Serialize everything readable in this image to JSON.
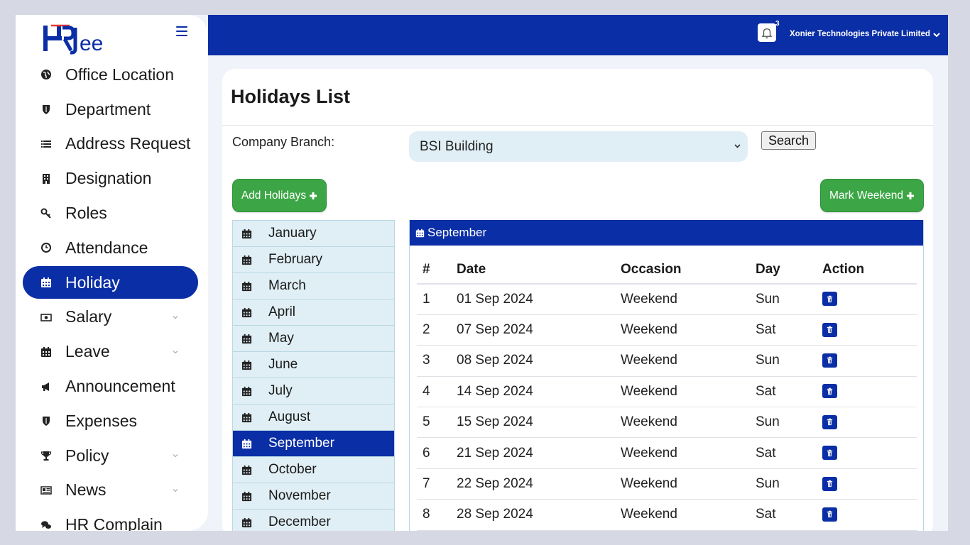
{
  "brand": {
    "logo_text": "HRJee"
  },
  "header": {
    "notification_count": "3",
    "company": "Xonier Technologies Private Limited",
    "icons": [
      "bell-icon",
      "chevron-down-icon"
    ]
  },
  "sidebar": {
    "items": [
      {
        "label": "Office Location",
        "icon": "globe-icon"
      },
      {
        "label": "Department",
        "icon": "shield-icon"
      },
      {
        "label": "Address Request",
        "icon": "list-icon"
      },
      {
        "label": "Designation",
        "icon": "building-icon"
      },
      {
        "label": "Roles",
        "icon": "key-icon"
      },
      {
        "label": "Attendance",
        "icon": "clock-icon"
      },
      {
        "label": "Holiday",
        "icon": "calendar-icon",
        "active": true
      },
      {
        "label": "Salary",
        "icon": "money-icon",
        "has_submenu": true
      },
      {
        "label": "Leave",
        "icon": "calendar-icon",
        "has_submenu": true
      },
      {
        "label": "Announcement",
        "icon": "megaphone-icon"
      },
      {
        "label": "Expenses",
        "icon": "shield-icon"
      },
      {
        "label": "Policy",
        "icon": "trophy-icon",
        "has_submenu": true
      },
      {
        "label": "News",
        "icon": "newspaper-icon",
        "has_submenu": true
      },
      {
        "label": "HR Complain",
        "icon": "comments-icon"
      }
    ]
  },
  "main": {
    "title": "Holidays List",
    "branch_label": "Company Branch:",
    "branch_value": "BSI Building",
    "search_label": "Search",
    "add_label": "Add Holidays",
    "mark_label": "Mark Weekend",
    "months": [
      "January",
      "February",
      "March",
      "April",
      "May",
      "June",
      "July",
      "August",
      "September",
      "October",
      "November",
      "December"
    ],
    "selected_month": "September",
    "table": {
      "caption": "September",
      "headers": [
        "#",
        "Date",
        "Occasion",
        "Day",
        "Action"
      ],
      "rows": [
        {
          "num": "1",
          "date": "01 Sep 2024",
          "occasion": "Weekend",
          "day": "Sun"
        },
        {
          "num": "2",
          "date": "07 Sep 2024",
          "occasion": "Weekend",
          "day": "Sat"
        },
        {
          "num": "3",
          "date": "08 Sep 2024",
          "occasion": "Weekend",
          "day": "Sun"
        },
        {
          "num": "4",
          "date": "14 Sep 2024",
          "occasion": "Weekend",
          "day": "Sat"
        },
        {
          "num": "5",
          "date": "15 Sep 2024",
          "occasion": "Weekend",
          "day": "Sun"
        },
        {
          "num": "6",
          "date": "21 Sep 2024",
          "occasion": "Weekend",
          "day": "Sat"
        },
        {
          "num": "7",
          "date": "22 Sep 2024",
          "occasion": "Weekend",
          "day": "Sun"
        },
        {
          "num": "8",
          "date": "28 Sep 2024",
          "occasion": "Weekend",
          "day": "Sat"
        }
      ]
    }
  },
  "colors": {
    "primary": "#0a2ea6",
    "success": "#3ca646",
    "light_blue": "#e0eff5",
    "background": "#f1f3fa"
  }
}
